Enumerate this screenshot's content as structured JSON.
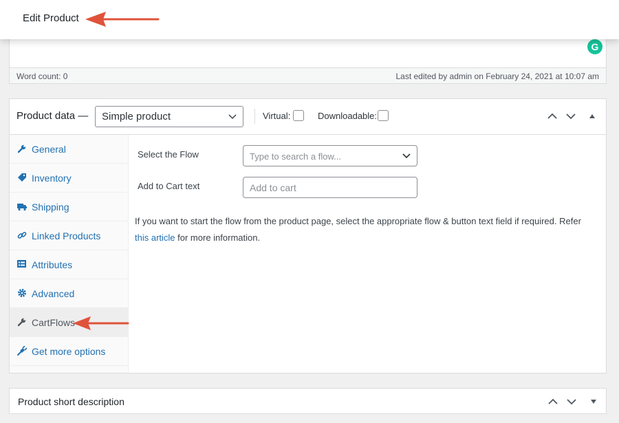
{
  "header": {
    "title": "Edit Product"
  },
  "editor": {
    "grammarly_letter": "G",
    "word_count": "Word count: 0",
    "last_edited": "Last edited by admin on February 24, 2021 at 10:07 am"
  },
  "product_data": {
    "title": "Product data —",
    "product_type": "Simple product",
    "virtual_label": "Virtual:",
    "downloadable_label": "Downloadable:",
    "tabs": [
      {
        "label": "General",
        "icon": "wrench-icon"
      },
      {
        "label": "Inventory",
        "icon": "tag-icon"
      },
      {
        "label": "Shipping",
        "icon": "truck-icon"
      },
      {
        "label": "Linked Products",
        "icon": "link-icon"
      },
      {
        "label": "Attributes",
        "icon": "list-icon"
      },
      {
        "label": "Advanced",
        "icon": "gear-icon"
      },
      {
        "label": "CartFlows",
        "icon": "wrench-icon"
      },
      {
        "label": "Get more options",
        "icon": "plug-icon"
      }
    ],
    "active_tab": "CartFlows",
    "flow_label": "Select the Flow",
    "flow_placeholder": "Type to search a flow...",
    "cart_text_label": "Add to Cart text",
    "cart_text_placeholder": "Add to cart",
    "desc_text": "If you want to start the flow from the product page, select the appropriate flow & button text field if required. Refer ",
    "desc_link": "this article",
    "desc_tail": " for more information."
  },
  "short_description": {
    "title": "Product short description"
  },
  "colors": {
    "accent": "#2271b1",
    "arrow": "#e0533b",
    "grammarly": "#15c39a"
  }
}
